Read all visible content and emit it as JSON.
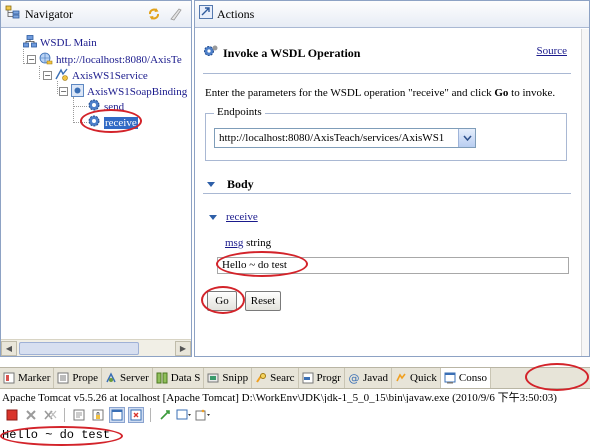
{
  "navigator": {
    "title": "Navigator",
    "tree": [
      {
        "label": "WSDL Main"
      },
      {
        "label": "http://localhost:8080/AxisTe"
      },
      {
        "label": "AxisWS1Service"
      },
      {
        "label": "AxisWS1SoapBinding"
      },
      {
        "label": "send"
      },
      {
        "label": "receive"
      }
    ]
  },
  "actions": {
    "title": "Actions",
    "heading": "Invoke a WSDL Operation",
    "source_link": "Source",
    "intro_prefix": "Enter the parameters for the WSDL operation \"receive\" and click ",
    "intro_bold": "Go",
    "intro_suffix": " to invoke.",
    "endpoints_label": "Endpoints",
    "endpoint_value": "http://localhost:8080/AxisTeach/services/AxisWS1",
    "body_label": "Body",
    "operation": "receive",
    "param_name": "msg",
    "param_type": "string",
    "param_value": "Hello ~ do test",
    "go_label": "Go",
    "reset_label": "Reset"
  },
  "bottom_tabs": [
    {
      "label": "Marker"
    },
    {
      "label": "Prope"
    },
    {
      "label": "Server"
    },
    {
      "label": "Data S"
    },
    {
      "label": "Snipp"
    },
    {
      "label": "Searc"
    },
    {
      "label": "Progr"
    },
    {
      "label": "Javad"
    },
    {
      "label": "Quick"
    },
    {
      "label": "Conso",
      "active": true
    }
  ],
  "console": {
    "header": "Apache Tomcat v5.5.26 at localhost [Apache Tomcat] D:\\WorkEnv\\JDK\\jdk-1_5_0_15\\bin\\javaw.exe (2010/9/6 下午3:50:03)",
    "output": "Hello ~ do test"
  },
  "colors": {
    "selection": "#316ac5",
    "link": "#1a1a8c",
    "annotation_red": "#d3232a",
    "pane_border": "#8da2c4"
  }
}
